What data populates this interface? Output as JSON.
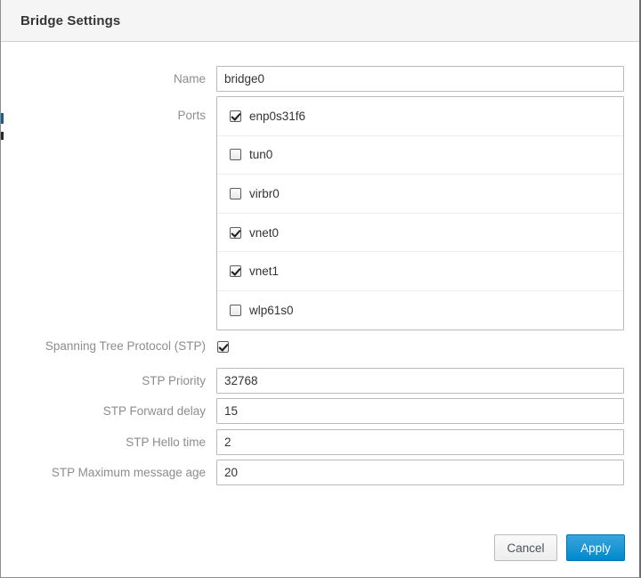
{
  "dialog": {
    "title": "Bridge Settings"
  },
  "form": {
    "name": {
      "label": "Name",
      "value": "bridge0",
      "placeholder": ""
    },
    "ports": {
      "label": "Ports",
      "items": [
        {
          "label": "enp0s31f6",
          "checked": true
        },
        {
          "label": "tun0",
          "checked": false
        },
        {
          "label": "virbr0",
          "checked": false
        },
        {
          "label": "vnet0",
          "checked": true
        },
        {
          "label": "vnet1",
          "checked": true
        },
        {
          "label": "wlp61s0",
          "checked": false
        }
      ]
    },
    "stp": {
      "label": "Spanning Tree Protocol (STP)",
      "checked": true
    },
    "stp_priority": {
      "label": "STP Priority",
      "value": "32768"
    },
    "stp_forward_delay": {
      "label": "STP Forward delay",
      "value": "15"
    },
    "stp_hello_time": {
      "label": "STP Hello time",
      "value": "2"
    },
    "stp_max_message_age": {
      "label": "STP Maximum message age",
      "value": "20"
    }
  },
  "footer": {
    "cancel_label": "Cancel",
    "apply_label": "Apply"
  },
  "colors": {
    "header_bg": "#f5f5f5",
    "label_text": "#8b8d8f",
    "primary_button": "#0088ce",
    "border": "#bbbbbb"
  }
}
